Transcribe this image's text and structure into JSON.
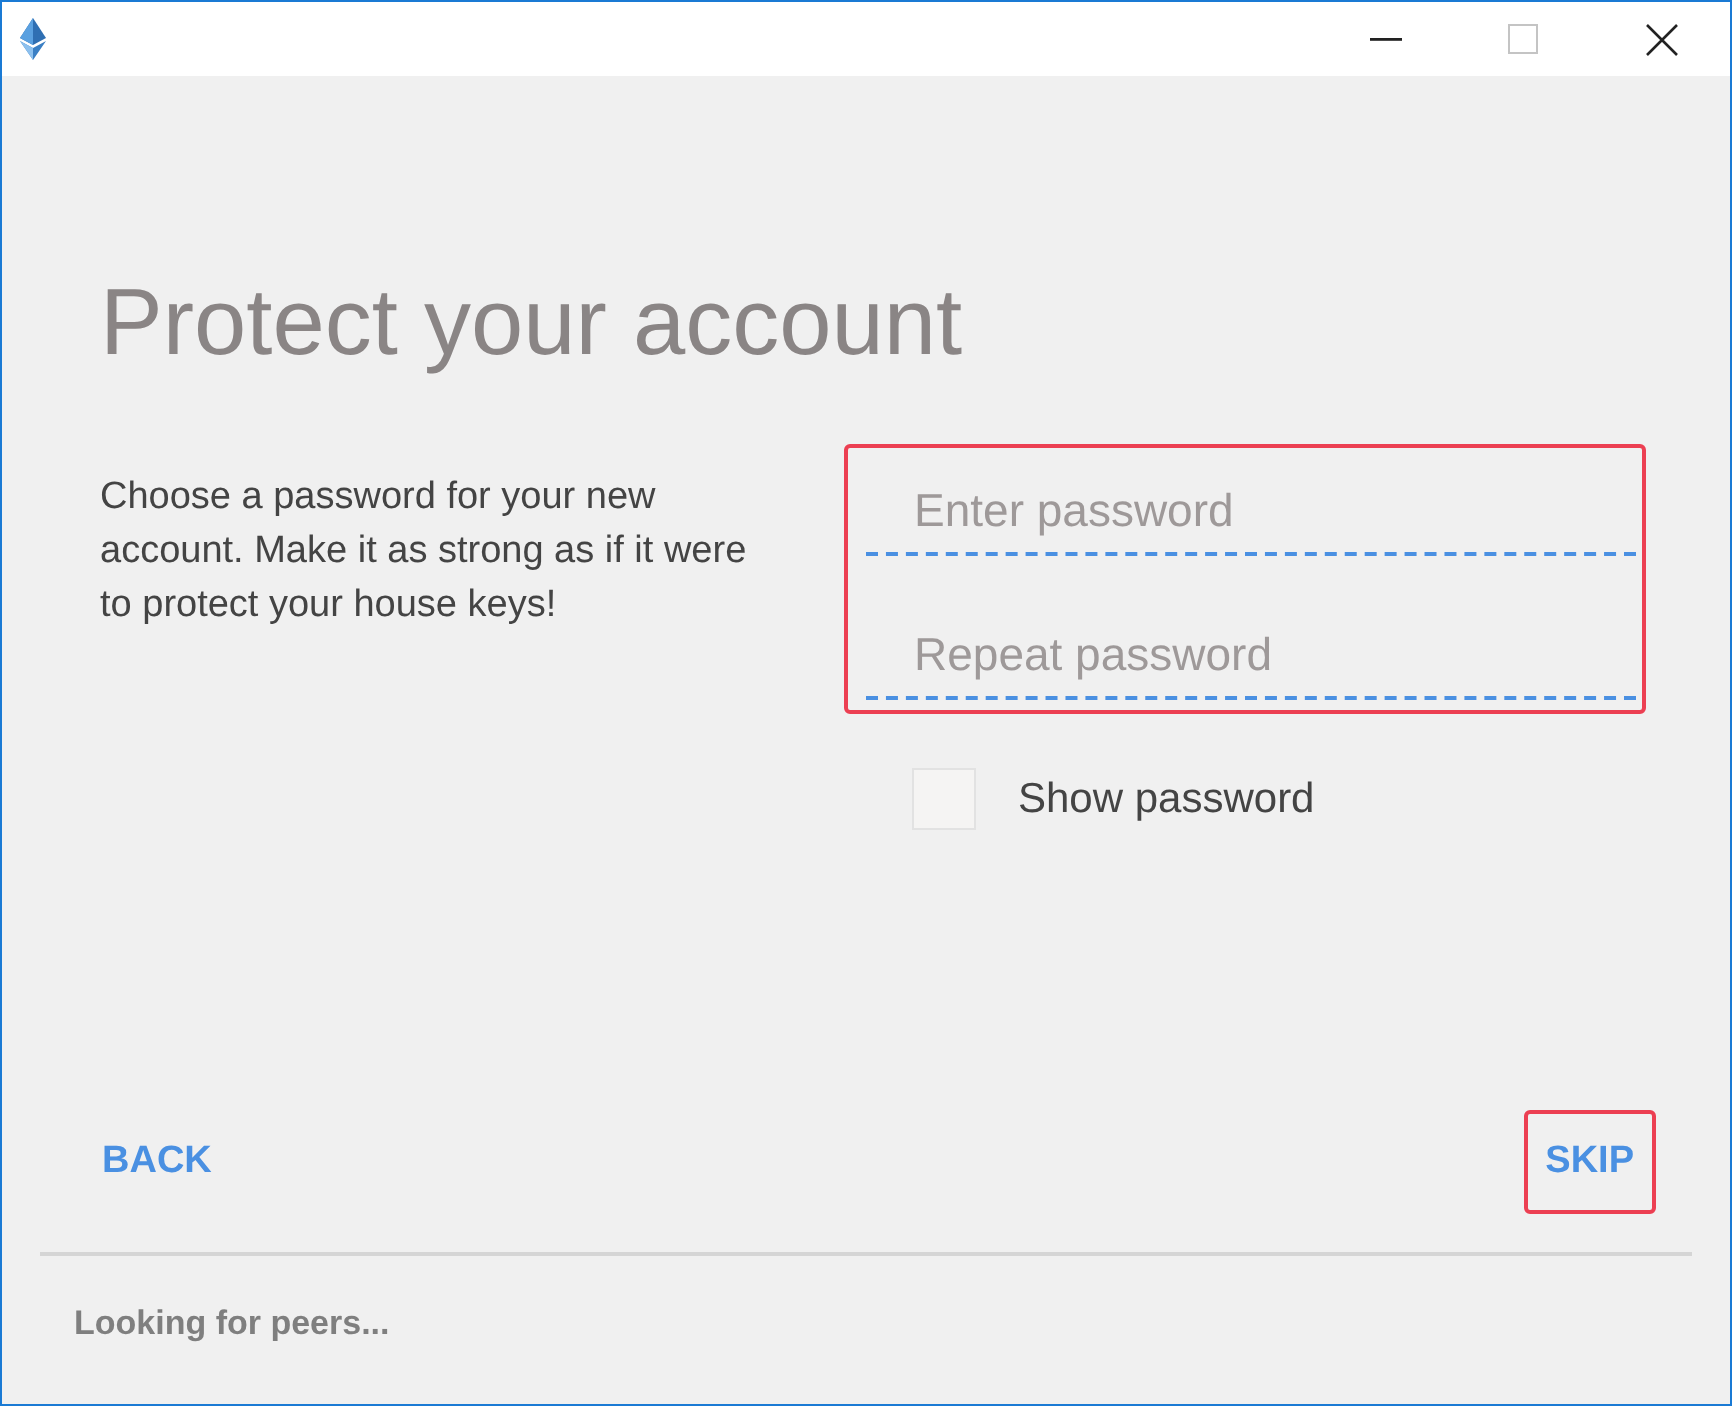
{
  "window": {
    "controls": [
      {
        "kind": "minimize",
        "disabled": false
      },
      {
        "kind": "maximize",
        "disabled": true
      },
      {
        "kind": "close",
        "disabled": false
      }
    ]
  },
  "heading": "Protect your account",
  "description": "Choose a password for your new account. Make it as strong as if it were to protect your house keys!",
  "password_fields": {
    "highlighted": true,
    "fields": [
      {
        "placeholder": "Enter password"
      },
      {
        "placeholder": "Repeat password"
      }
    ]
  },
  "show_password": {
    "label": "Show password",
    "checked": false
  },
  "buttons": [
    {
      "label": "BACK",
      "highlighted": false
    },
    {
      "label": "SKIP",
      "highlighted": true
    }
  ],
  "status_bar": {
    "text": "Looking for peers..."
  }
}
